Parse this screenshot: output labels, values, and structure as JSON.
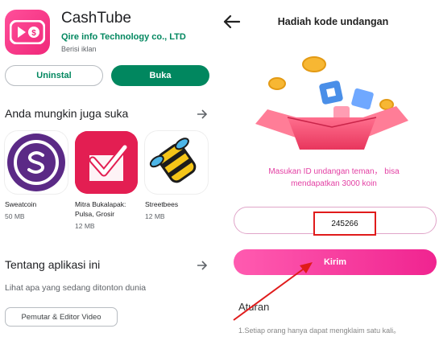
{
  "play_store": {
    "app": {
      "name": "CashTube",
      "developer": "Qire info Technology co., LTD",
      "ads_label": "Berisi iklan",
      "icon": "cashtube-logo-icon"
    },
    "buttons": {
      "uninstall_label": "Uninstal",
      "open_label": "Buka"
    },
    "recommend": {
      "title": "Anda mungkin juga suka",
      "items": [
        {
          "name": "Sweatcoin",
          "size": "50 MB",
          "icon": "sweatcoin-icon",
          "color": "#5b2a86"
        },
        {
          "name": "Mitra Bukalapak: Pulsa, Grosir",
          "size": "12 MB",
          "icon": "mitra-bukalapak-icon",
          "color": "#e31e52"
        },
        {
          "name": "Streetbees",
          "size": "12 MB",
          "icon": "streetbees-icon",
          "color": "#f5c518"
        }
      ]
    },
    "about": {
      "title": "Tentang aplikasi ini",
      "description": "Lihat apa yang sedang ditonton dunia",
      "category_chip": "Pemutar & Editor Video"
    }
  },
  "invite_screen": {
    "title": "Hadiah kode undangan",
    "instruction_line1": "Masukan ID undangan teman， bisa",
    "instruction_line2": "mendapatkan 3000 koin",
    "code_value": "245266",
    "submit_label": "Kirim",
    "rules_title": "Aturan",
    "rules_line1": "1.Setiap orang hanya dapat mengklaim satu kali。",
    "colors": {
      "accent_pink": "#f02490",
      "instruction_pink": "#e33fa3",
      "highlight_red": "#e01b1b"
    }
  }
}
